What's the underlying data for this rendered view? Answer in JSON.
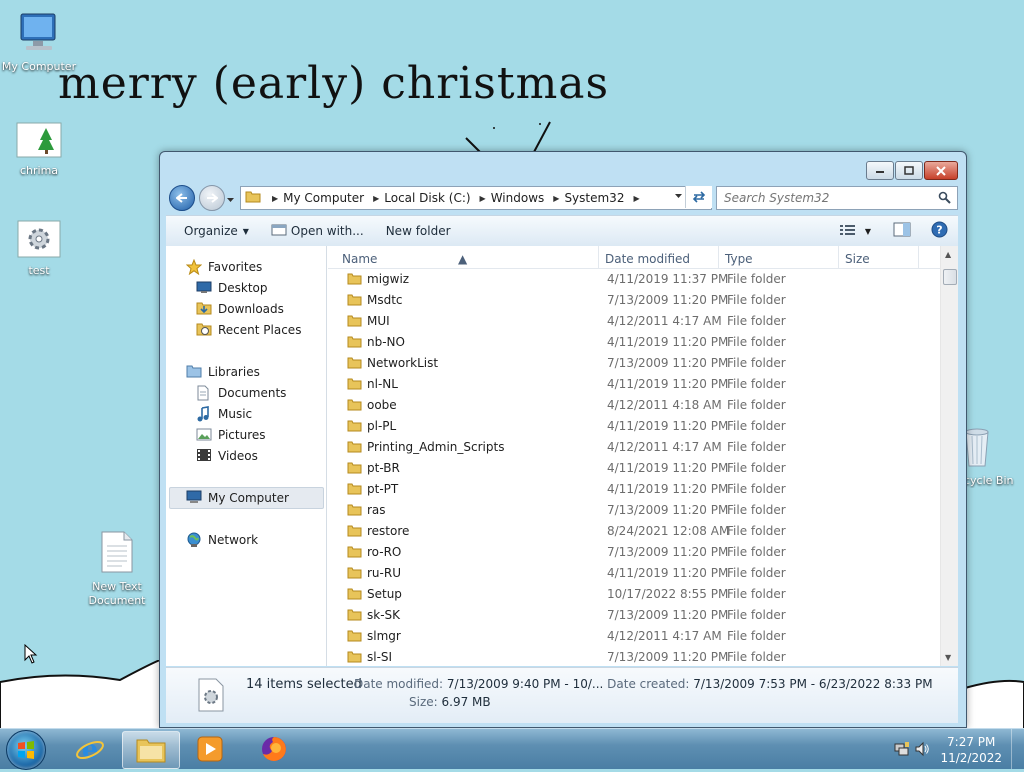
{
  "desktop": {
    "wallpaper_text": "merry (early) christmas",
    "icons": [
      {
        "label": "My Computer"
      },
      {
        "label": "chrima"
      },
      {
        "label": "test"
      },
      {
        "label": "New Text Document"
      },
      {
        "label": "cycle Bin"
      }
    ]
  },
  "window": {
    "breadcrumb": [
      "My Computer",
      "Local Disk (C:)",
      "Windows",
      "System32"
    ],
    "search_placeholder": "Search System32",
    "toolbar": {
      "organize": "Organize",
      "open_with": "Open with...",
      "new_folder": "New folder"
    },
    "nav": {
      "favorites": "Favorites",
      "desktop": "Desktop",
      "downloads": "Downloads",
      "recent_places": "Recent Places",
      "libraries": "Libraries",
      "documents": "Documents",
      "music": "Music",
      "pictures": "Pictures",
      "videos": "Videos",
      "my_computer": "My Computer",
      "network": "Network"
    },
    "columns": {
      "name": "Name",
      "date_modified": "Date modified",
      "type": "Type",
      "size": "Size"
    },
    "files": [
      {
        "name": "migwiz",
        "date": "4/11/2019 11:37 PM",
        "type": "File folder"
      },
      {
        "name": "Msdtc",
        "date": "7/13/2009 11:20 PM",
        "type": "File folder"
      },
      {
        "name": "MUI",
        "date": "4/12/2011 4:17 AM",
        "type": "File folder"
      },
      {
        "name": "nb-NO",
        "date": "4/11/2019 11:20 PM",
        "type": "File folder"
      },
      {
        "name": "NetworkList",
        "date": "7/13/2009 11:20 PM",
        "type": "File folder"
      },
      {
        "name": "nl-NL",
        "date": "4/11/2019 11:20 PM",
        "type": "File folder"
      },
      {
        "name": "oobe",
        "date": "4/12/2011 4:18 AM",
        "type": "File folder"
      },
      {
        "name": "pl-PL",
        "date": "4/11/2019 11:20 PM",
        "type": "File folder"
      },
      {
        "name": "Printing_Admin_Scripts",
        "date": "4/12/2011 4:17 AM",
        "type": "File folder"
      },
      {
        "name": "pt-BR",
        "date": "4/11/2019 11:20 PM",
        "type": "File folder"
      },
      {
        "name": "pt-PT",
        "date": "4/11/2019 11:20 PM",
        "type": "File folder"
      },
      {
        "name": "ras",
        "date": "7/13/2009 11:20 PM",
        "type": "File folder"
      },
      {
        "name": "restore",
        "date": "8/24/2021 12:08 AM",
        "type": "File folder"
      },
      {
        "name": "ro-RO",
        "date": "7/13/2009 11:20 PM",
        "type": "File folder"
      },
      {
        "name": "ru-RU",
        "date": "4/11/2019 11:20 PM",
        "type": "File folder"
      },
      {
        "name": "Setup",
        "date": "10/17/2022 8:55 PM",
        "type": "File folder"
      },
      {
        "name": "sk-SK",
        "date": "7/13/2009 11:20 PM",
        "type": "File folder"
      },
      {
        "name": "slmgr",
        "date": "4/12/2011 4:17 AM",
        "type": "File folder"
      },
      {
        "name": "sl-SI",
        "date": "7/13/2009 11:20 PM",
        "type": "File folder"
      }
    ],
    "details": {
      "selected": "14 items selected",
      "date_modified_label": "Date modified:",
      "date_modified_value": "7/13/2009 9:40 PM - 10/...",
      "date_created_label": "Date created:",
      "date_created_value": "7/13/2009 7:53 PM - 6/23/2022 8:33 PM",
      "size_label": "Size:",
      "size_value": "6.97 MB"
    }
  },
  "taskbar": {
    "time": "7:27 PM",
    "date": "11/2/2022"
  }
}
